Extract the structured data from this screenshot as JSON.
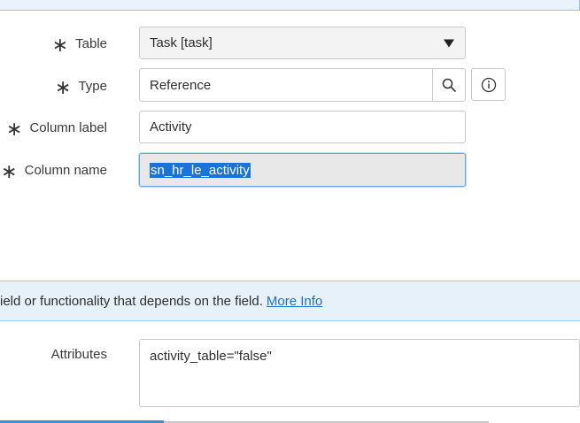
{
  "form": {
    "table": {
      "label": "Table",
      "value": "Task [task]"
    },
    "type": {
      "label": "Type",
      "value": "Reference",
      "lookup_icon": "search-icon",
      "info_icon": "info-icon"
    },
    "column_label": {
      "label": "Column label",
      "value": "Activity"
    },
    "column_name": {
      "label": "Column name",
      "value": "sn_hr_le_activity"
    },
    "required_marker": "∗"
  },
  "notice": {
    "text": "ield or functionality that depends on the field.",
    "link": "More Info"
  },
  "attributes": {
    "label": "Attributes",
    "value": "activity_table=\"false\""
  },
  "colors": {
    "accent": "#1a73d9",
    "notice_bg": "#e7f1fa",
    "link": "#1f6fbf"
  }
}
